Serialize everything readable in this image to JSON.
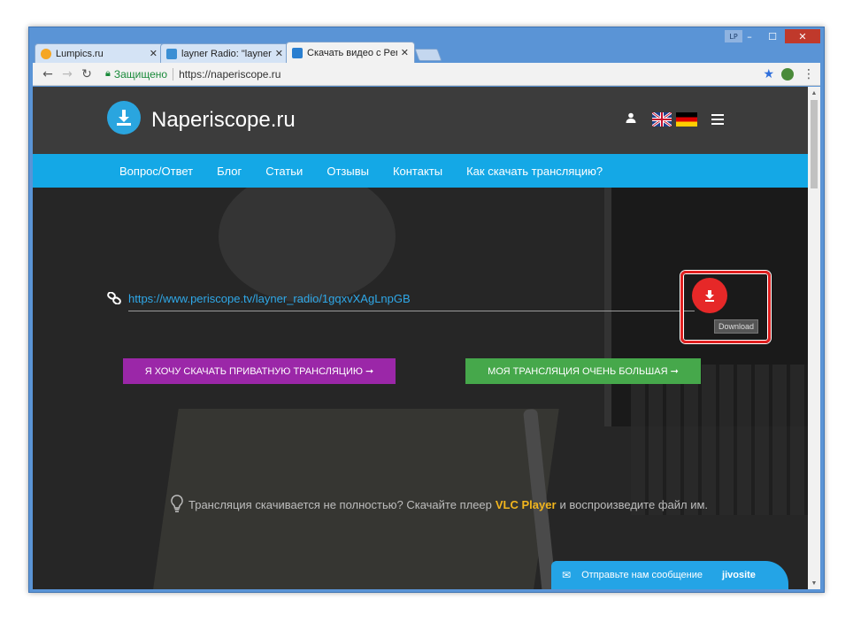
{
  "window": {
    "user_badge": "LP",
    "minimize_icon": "minimize-icon",
    "maximize_icon": "maximize-icon",
    "close_icon": "close-icon"
  },
  "tabs": [
    {
      "title": "Lumpics.ru",
      "favicon_color": "#f5a623"
    },
    {
      "title": "layner Radio: \"layner Radi",
      "favicon_color": "#3b8fd4"
    },
    {
      "title": "Скачать видео с Periscope",
      "favicon_color": "#2a7fd0"
    }
  ],
  "toolbar": {
    "secure_label": "Защищено",
    "url": "https://naperiscope.ru"
  },
  "site": {
    "name": "Naperiscope.ru",
    "brand_color": "#14a8e6",
    "nav": [
      "Вопрос/Ответ",
      "Блог",
      "Статьи",
      "Отзывы",
      "Контакты",
      "Как скачать трансляцию?"
    ]
  },
  "form": {
    "url_value": "https://www.periscope.tv/layner_radio/1gqxvXAgLnpGB",
    "download_tooltip": "Download",
    "private_button": "Я ХОЧУ СКАЧАТЬ ПРИВАТНУЮ ТРАНСЛЯЦИЮ ➞",
    "big_button": "МОЯ ТРАНСЛЯЦИЯ ОЧЕНЬ БОЛЬШАЯ ➞"
  },
  "tip": {
    "before": "Трансляция скачивается не полностью? Скачайте плеер",
    "highlight": "VLC Player",
    "after": "и воспроизведите файл им."
  },
  "chat": {
    "label": "Отправьте нам сообщение",
    "brand": "jivosite"
  }
}
